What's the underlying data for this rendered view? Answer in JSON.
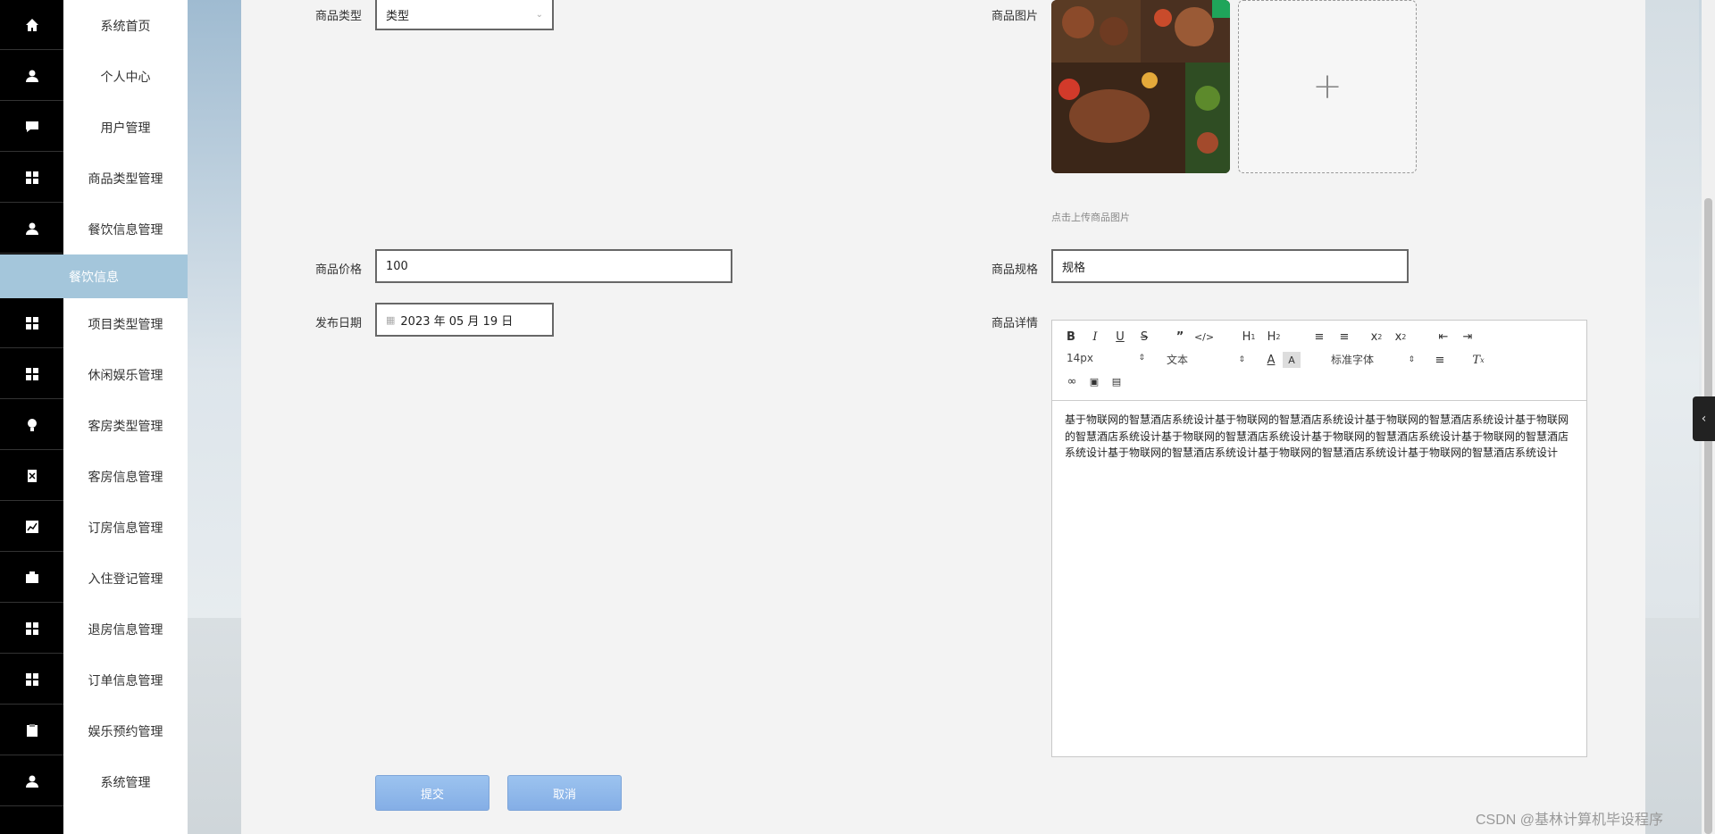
{
  "sidebar": {
    "items": [
      {
        "label": "系统首页",
        "icon": "home-icon"
      },
      {
        "label": "个人中心",
        "icon": "user-icon"
      },
      {
        "label": "用户管理",
        "icon": "chat-icon"
      },
      {
        "label": "商品类型管理",
        "icon": "grid-icon"
      },
      {
        "label": "餐饮信息管理",
        "icon": "user-icon"
      },
      {
        "label": "项目类型管理",
        "icon": "grid-icon"
      },
      {
        "label": "休闲娱乐管理",
        "icon": "grid-icon"
      },
      {
        "label": "客房类型管理",
        "icon": "bulb-icon"
      },
      {
        "label": "客房信息管理",
        "icon": "delete-doc-icon"
      },
      {
        "label": "订房信息管理",
        "icon": "chart-icon"
      },
      {
        "label": "入住登记管理",
        "icon": "briefcase-icon"
      },
      {
        "label": "退房信息管理",
        "icon": "grid-icon"
      },
      {
        "label": "订单信息管理",
        "icon": "grid-icon"
      },
      {
        "label": "娱乐预约管理",
        "icon": "clipboard-icon"
      },
      {
        "label": "系统管理",
        "icon": "user-icon"
      }
    ],
    "active_sub": "餐饮信息"
  },
  "form": {
    "type_label": "商品类型",
    "type_value": "类型",
    "image_label": "商品图片",
    "image_hint": "点击上传商品图片",
    "price_label": "商品价格",
    "price_value": "100",
    "spec_label": "商品规格",
    "spec_value": "规格",
    "date_label": "发布日期",
    "date_value": "2023 年 05 月 19 日",
    "detail_label": "商品详情"
  },
  "editor": {
    "font_size": "14px",
    "block_type": "文本",
    "font_family": "标准字体",
    "content": "基于物联网的智慧酒店系统设计基于物联网的智慧酒店系统设计基于物联网的智慧酒店系统设计基于物联网的智慧酒店系统设计基于物联网的智慧酒店系统设计基于物联网的智慧酒店系统设计基于物联网的智慧酒店系统设计基于物联网的智慧酒店系统设计基于物联网的智慧酒店系统设计基于物联网的智慧酒店系统设计"
  },
  "buttons": {
    "submit": "提交",
    "cancel": "取消"
  },
  "watermark": "CSDN @基林计算机毕设程序"
}
